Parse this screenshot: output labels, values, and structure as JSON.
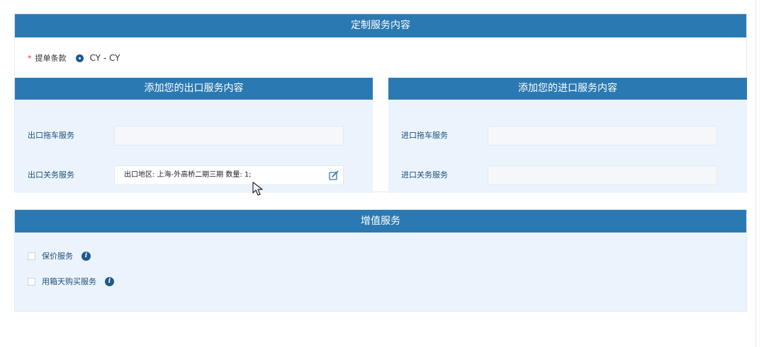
{
  "custom_section": {
    "title": "定制服务内容",
    "terms": {
      "required_mark": "*",
      "label": "提单条款",
      "selected_value": "CY - CY"
    }
  },
  "export_panel": {
    "title": "添加您的出口服务内容",
    "trailer_label": "出口拖车服务",
    "trailer_value": "",
    "customs_label": "出口关务服务",
    "customs_value": "出口地区: 上海-外高桥二期三期  数量: 1;"
  },
  "import_panel": {
    "title": "添加您的进口服务内容",
    "trailer_label": "进口拖车服务",
    "trailer_value": "",
    "customs_label": "进口关务服务",
    "customs_value": ""
  },
  "value_added": {
    "title": "增值服务",
    "options": [
      {
        "label": "保价服务",
        "checked": false,
        "icon": "info-icon"
      },
      {
        "label": "用箱天购买服务",
        "checked": false,
        "icon": "info-icon"
      }
    ]
  },
  "colors": {
    "header_bar": "#2b79b2",
    "panel_bg": "#ebf4fd",
    "label_text": "#1f4e79",
    "required": "#e0301e"
  }
}
